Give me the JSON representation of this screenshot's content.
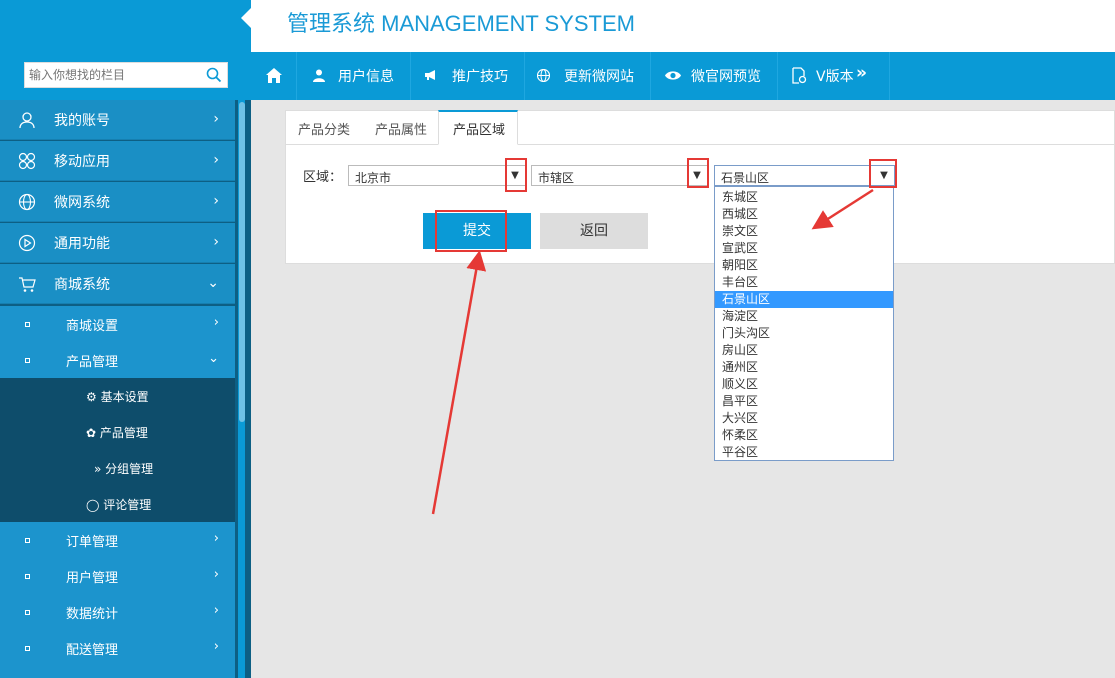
{
  "header": {
    "title": "管理系统 MANAGEMENT SYSTEM"
  },
  "sidebar": {
    "search_placeholder": "输入你想找的栏目",
    "menu": [
      {
        "label": "我的账号",
        "icon": "user-icon"
      },
      {
        "label": "移动应用",
        "icon": "apps-icon"
      },
      {
        "label": "微网系统",
        "icon": "globe-icon"
      },
      {
        "label": "通用功能",
        "icon": "play-icon"
      },
      {
        "label": "商城系统",
        "icon": "cart-icon"
      }
    ],
    "mall_sub": [
      {
        "label": "商城设置"
      },
      {
        "label": "产品管理"
      }
    ],
    "product_leaves": [
      {
        "label": "基本设置",
        "icon": "gear-icon"
      },
      {
        "label": "产品管理",
        "icon": "puzzle-icon"
      },
      {
        "label": "分组管理",
        "icon": "double-chevron-icon"
      },
      {
        "label": "评论管理",
        "icon": "comment-icon"
      }
    ],
    "mall_sub_after": [
      {
        "label": "订单管理"
      },
      {
        "label": "用户管理"
      },
      {
        "label": "数据统计"
      },
      {
        "label": "配送管理"
      }
    ]
  },
  "topnav": [
    {
      "label": "",
      "icon": "home-icon"
    },
    {
      "label": "用户信息",
      "icon": "person-icon"
    },
    {
      "label": "推广技巧",
      "icon": "megaphone-icon"
    },
    {
      "label": "更新微网站",
      "icon": "globe-icon"
    },
    {
      "label": "微官网预览",
      "icon": "eye-icon"
    },
    {
      "label": "V版本",
      "icon": "doc-gear-icon"
    }
  ],
  "tabs": [
    "产品分类",
    "产品属性",
    "产品区域"
  ],
  "form": {
    "region_label": "区域：",
    "province": "北京市",
    "city": "市辖区",
    "district": "石景山区",
    "submit": "提交",
    "back": "返回"
  },
  "dropdown_options": [
    "东城区",
    "西城区",
    "崇文区",
    "宣武区",
    "朝阳区",
    "丰台区",
    "石景山区",
    "海淀区",
    "门头沟区",
    "房山区",
    "通州区",
    "顺义区",
    "昌平区",
    "大兴区",
    "怀柔区",
    "平谷区"
  ],
  "dropdown_selected_index": 6,
  "colors": {
    "accent": "#0a9ad6",
    "sidebar": "#1a8fc5",
    "annotation": "#e53935"
  }
}
